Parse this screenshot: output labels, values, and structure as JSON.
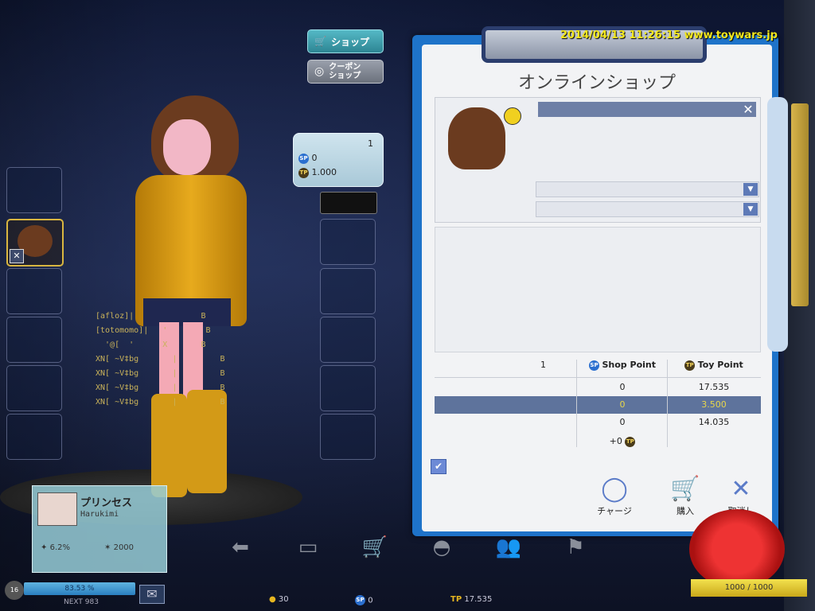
{
  "timestamp": "2014/04/13 11:26:15 www.toywars.jp",
  "menu": {
    "shop_label": "ショップ",
    "coupon_label_1": "クーポン",
    "coupon_label_2": "ショップ"
  },
  "price_bubble": {
    "qty": "1",
    "sp": "0",
    "tp": "1.000"
  },
  "chat_lines": [
    "[afloz]|              B",
    "[totomomo]|   '        B",
    "  '@[  '      X       B",
    "XN[ ~V‡bg       |         B",
    "XN[ ~V‡bg       |         B",
    "XN[ ~V‡bg       |         B",
    "XN[ ~V‡bg       |         B"
  ],
  "shop": {
    "title": "オンラインショップ",
    "item_name": "",
    "close_label": "✕",
    "dropdown1": "",
    "dropdown2": "",
    "table": {
      "header_qty": "1",
      "header_sp": "Shop Point",
      "header_tp": "Toy Point",
      "rows": [
        {
          "sp": "0",
          "tp": "17.535"
        },
        {
          "sp": "0",
          "tp": "3.500"
        },
        {
          "sp": "0",
          "tp": "14.035"
        }
      ],
      "bonus": "+0"
    },
    "buttons": {
      "charge": "チャージ",
      "buy": "購入",
      "cancel": "取消し"
    }
  },
  "profile": {
    "name": "プリンセス",
    "sub": "Harukimi",
    "stat1": "6.2%",
    "stat2": "2000",
    "exp": "83.53 %",
    "next": "NEXT 983",
    "level": "16"
  },
  "bottom": {
    "gold": "30",
    "sp": "0",
    "tp_label": "TP",
    "tp": "17.535",
    "hp": "1000 / 1000"
  },
  "colors": {
    "panel": "#1e73c9",
    "highlight_row": "#5e739c",
    "highlight_text": "#e9d74a",
    "timestamp": "#f2e61c"
  }
}
